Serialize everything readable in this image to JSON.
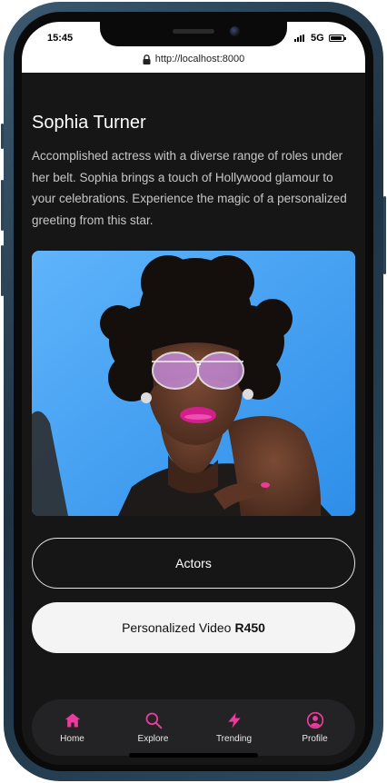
{
  "status": {
    "time": "15:45",
    "network": "5G"
  },
  "browser": {
    "url": "http://localhost:8000"
  },
  "profile": {
    "name": "Sophia Turner",
    "description": "Accomplished actress with a diverse range of roles under her belt. Sophia brings a touch of Hollywood glamour to your celebrations. Experience the magic of a personalized greeting from this star.",
    "photo_icon": "portrait-photo"
  },
  "actions": {
    "category_label": "Actors",
    "video_label": "Personalized Video",
    "video_price": "R450"
  },
  "nav": {
    "items": [
      {
        "label": "Home",
        "icon": "home-icon"
      },
      {
        "label": "Explore",
        "icon": "search-icon"
      },
      {
        "label": "Trending",
        "icon": "lightning-icon"
      },
      {
        "label": "Profile",
        "icon": "user-circle-icon"
      }
    ]
  },
  "colors": {
    "accent": "#ec3b9c",
    "background": "#161617",
    "nav_bg": "#232325"
  }
}
